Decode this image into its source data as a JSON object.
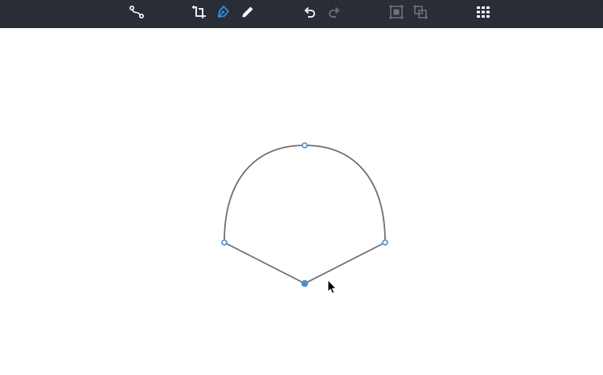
{
  "toolbar": {
    "tools": [
      {
        "id": "path-tool",
        "icon": "path-nodes-icon",
        "enabled": true,
        "active": false
      },
      {
        "id": "crop-tool",
        "icon": "crop-add-icon",
        "enabled": true,
        "active": false
      },
      {
        "id": "pen-tool",
        "icon": "pen-nib-icon",
        "enabled": true,
        "active": true
      },
      {
        "id": "pencil-tool",
        "icon": "pencil-icon",
        "enabled": true,
        "active": false
      },
      {
        "id": "undo",
        "icon": "undo-icon",
        "enabled": true,
        "active": false
      },
      {
        "id": "redo",
        "icon": "redo-icon",
        "enabled": false,
        "active": false
      },
      {
        "id": "group",
        "icon": "group-icon",
        "enabled": false,
        "active": false
      },
      {
        "id": "ungroup",
        "icon": "ungroup-icon",
        "enabled": false,
        "active": false
      },
      {
        "id": "grid",
        "icon": "grid-icon",
        "enabled": true,
        "active": false
      }
    ]
  },
  "colors": {
    "toolbar_bg": "#262a33",
    "icon_default": "#ffffff",
    "icon_active": "#2e8fe8",
    "icon_disabled": "#6c717a",
    "path_stroke": "#6f6f6f",
    "anchor_stroke": "#4a8fd0",
    "anchor_fill_selected": "#4a8fd0",
    "canvas_bg": "#ffffff"
  }
}
